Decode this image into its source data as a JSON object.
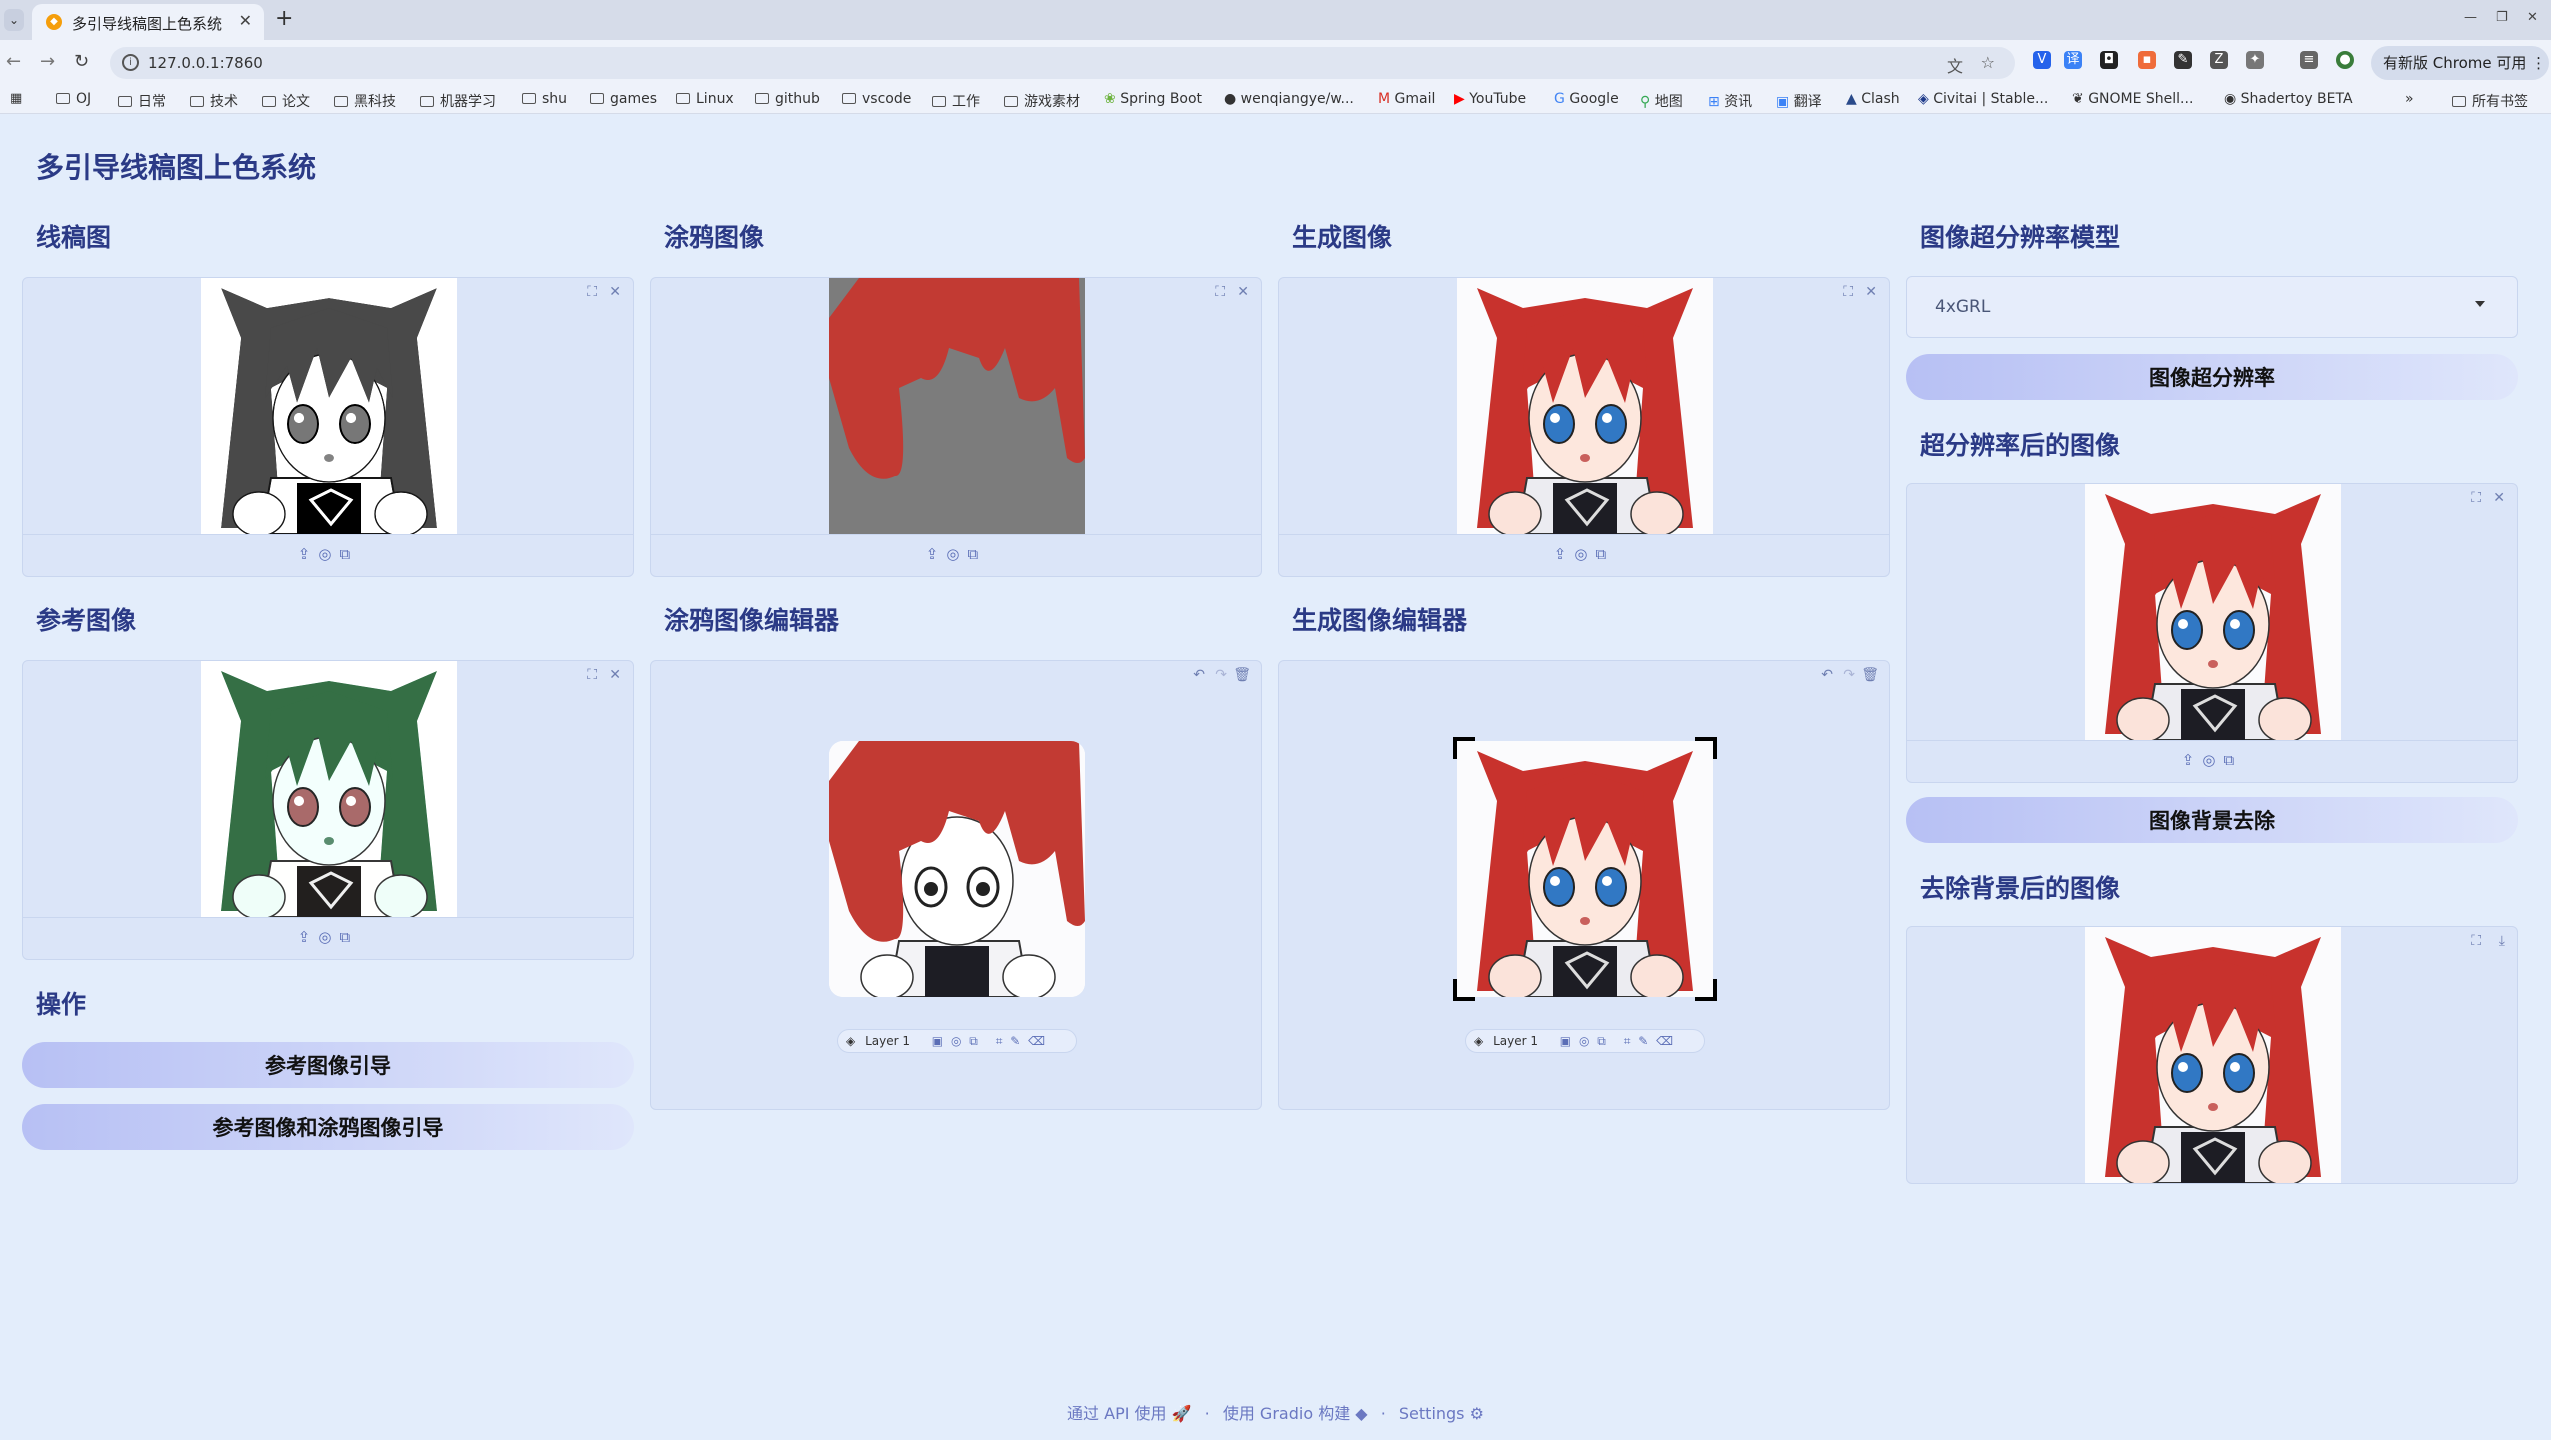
{
  "browser": {
    "tab_title": "多引导线稿图上色系统",
    "url": "127.0.0.1:7860",
    "update_label": "有新版 Chrome 可用",
    "bookmarks": [
      "OJ",
      "日常",
      "技术",
      "论文",
      "黑科技",
      "机器学习",
      "shu",
      "games",
      "Linux",
      "github",
      "vscode",
      "工作",
      "游戏素材",
      "Spring Boot",
      "wenqiangye/w...",
      "Gmail",
      "YouTube",
      "Google",
      "地图",
      "资讯",
      "翻译",
      "Clash",
      "Civitai | Stable...",
      "GNOME Shell...",
      "Shadertoy BETA"
    ],
    "all_bookmarks": "所有书签"
  },
  "page": {
    "title": "多引导线稿图上色系统",
    "lineart_label": "线稿图",
    "scribble_label": "涂鸦图像",
    "generated_label": "生成图像",
    "sr_model_label": "图像超分辨率模型",
    "sr_model_value": "4xGRL",
    "sr_button": "图像超分辨率",
    "sr_result_label": "超分辨率后的图像",
    "reference_label": "参考图像",
    "scribble_editor_label": "涂鸦图像编辑器",
    "generated_editor_label": "生成图像编辑器",
    "bg_remove_button": "图像背景去除",
    "bg_removed_label": "去除背景后的图像",
    "actions_label": "操作",
    "ref_guide_button": "参考图像引导",
    "ref_scribble_guide_button": "参考图像和涂鸦图像引导",
    "layer_label": "Layer 1"
  },
  "footer": {
    "api": "通过 API 使用",
    "built": "使用 Gradio 构建",
    "settings": "Settings"
  },
  "colors": {
    "accent": "#2b3a86",
    "hair_red": "#c8322d",
    "hair_green": "#7f9e93",
    "scribble_bg": "#7c7c7c"
  }
}
